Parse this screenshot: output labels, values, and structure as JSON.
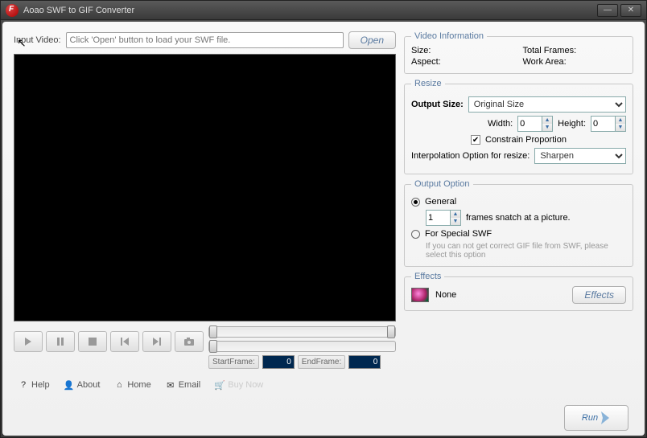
{
  "title": "Aoao SWF to GIF Converter",
  "input": {
    "label": "Input Video:",
    "placeholder": "Click 'Open' button to load your SWF file.",
    "open_btn": "Open"
  },
  "player": {
    "start_label": "StartFrame:",
    "start_value": "0",
    "end_label": "EndFrame:",
    "end_value": "0"
  },
  "video_info": {
    "legend": "Video Information",
    "size_label": "Size:",
    "frames_label": "Total Frames:",
    "aspect_label": "Aspect:",
    "area_label": "Work Area:"
  },
  "resize": {
    "legend": "Resize",
    "output_size_label": "Output Size:",
    "output_size_value": "Original Size",
    "width_label": "Width:",
    "width_value": "0",
    "height_label": "Height:",
    "height_value": "0",
    "constrain_label": "Constrain Proportion",
    "interp_label": "Interpolation Option for resize:",
    "interp_value": "Sharpen"
  },
  "output": {
    "legend": "Output Option",
    "general_label": "General",
    "snatch_value": "1",
    "snatch_label": "frames snatch at a picture.",
    "special_label": "For Special SWF",
    "special_hint": "If you can not get correct GIF file from SWF, please select this option"
  },
  "effects": {
    "legend": "Effects",
    "value": "None",
    "btn": "Effects"
  },
  "run_label": "Run",
  "footer": {
    "help": "Help",
    "about": "About",
    "home": "Home",
    "email": "Email",
    "buy": "Buy Now"
  }
}
